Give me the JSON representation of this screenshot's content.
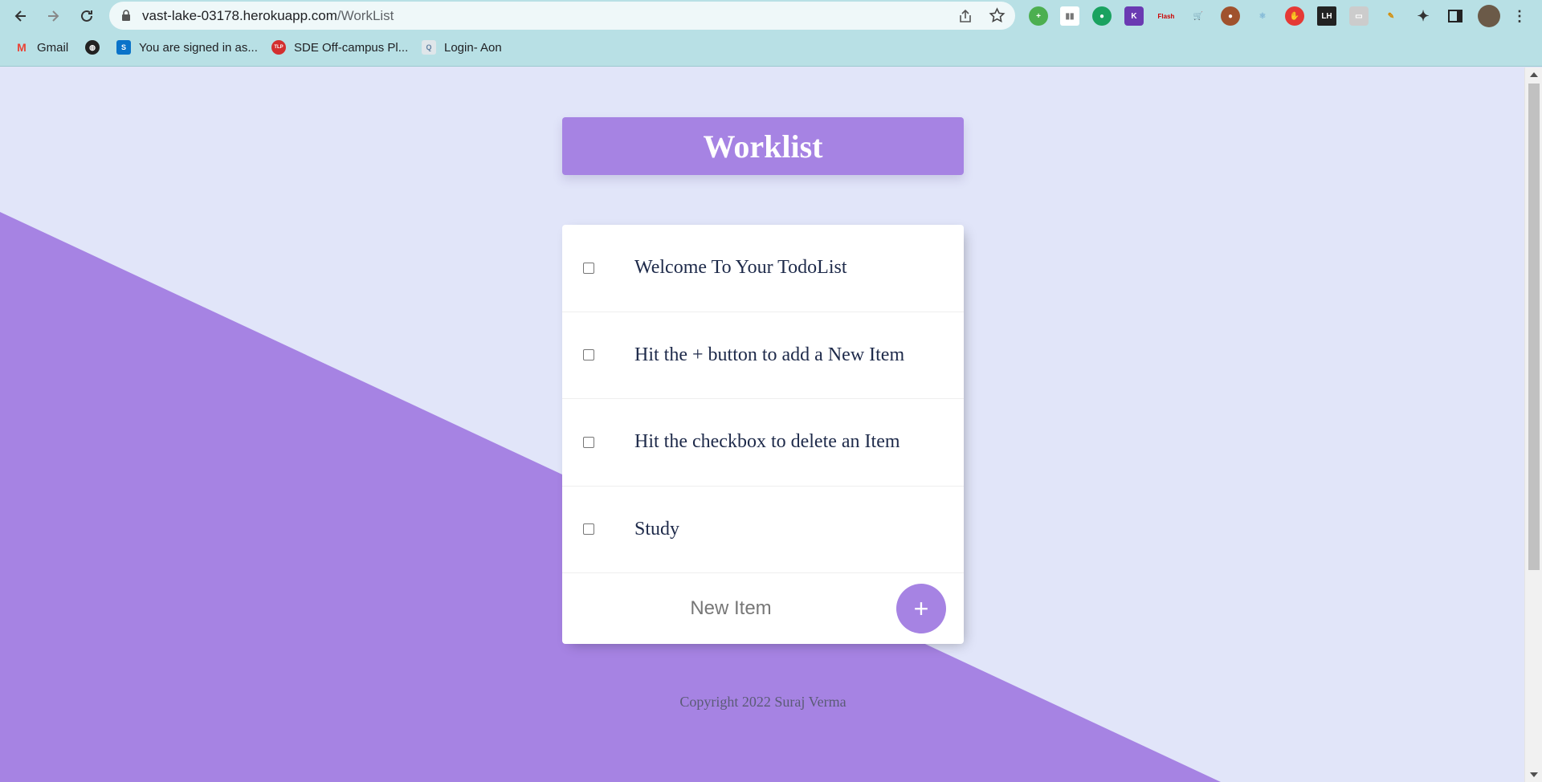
{
  "browser": {
    "url_host": "vast-lake-03178.herokuapp.com",
    "url_path": "/WorkList",
    "bookmarks": [
      {
        "label": "Gmail",
        "icon": "gmail-icon"
      },
      {
        "label": "",
        "icon": "globe-icon"
      },
      {
        "label": "You are signed in as...",
        "icon": "s-icon"
      },
      {
        "label": "SDE Off-campus Pl...",
        "icon": "tlp-icon"
      },
      {
        "label": "Login- Aon",
        "icon": "aon-icon"
      }
    ]
  },
  "page": {
    "title": "Worklist",
    "items": [
      {
        "text": "Welcome To Your TodoList",
        "checked": false
      },
      {
        "text": "Hit the + button to add a New Item",
        "checked": false
      },
      {
        "text": "Hit the checkbox to delete an Item",
        "checked": false
      },
      {
        "text": "Study",
        "checked": false
      }
    ],
    "new_item_placeholder": "New Item",
    "add_button_label": "+",
    "footer": "Copyright 2022 Suraj Verma"
  },
  "colors": {
    "accent": "#A683E3",
    "background": "#E1E5F9",
    "chrome": "#B8E0E5"
  }
}
